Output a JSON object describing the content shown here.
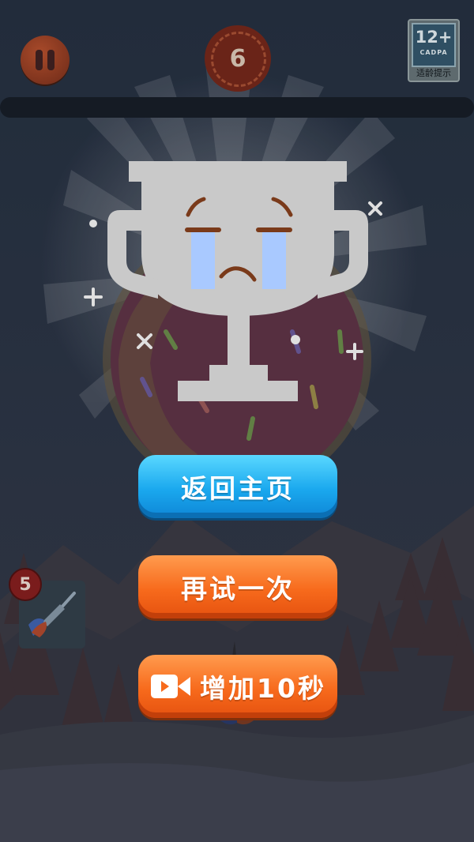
{
  "hud": {
    "timer_value": "6",
    "age_rating": {
      "number": "12+",
      "code": "CADPA",
      "caption": "适龄提示"
    }
  },
  "result": {
    "state": "fail",
    "trophy_face": "crying"
  },
  "buttons": {
    "home_label": "返回主页",
    "retry_label": "再试一次",
    "add_time_label": "增加10秒"
  },
  "darts": {
    "remaining": "5"
  },
  "colors": {
    "home_button": "#1aa8ee",
    "retry_button": "#f76a1c",
    "add_time_button": "#f76a1c",
    "trophy": "#c9c9c9"
  },
  "icons": {
    "pause": "pause-icon",
    "video": "video-camera-icon",
    "dart": "dart-icon"
  }
}
